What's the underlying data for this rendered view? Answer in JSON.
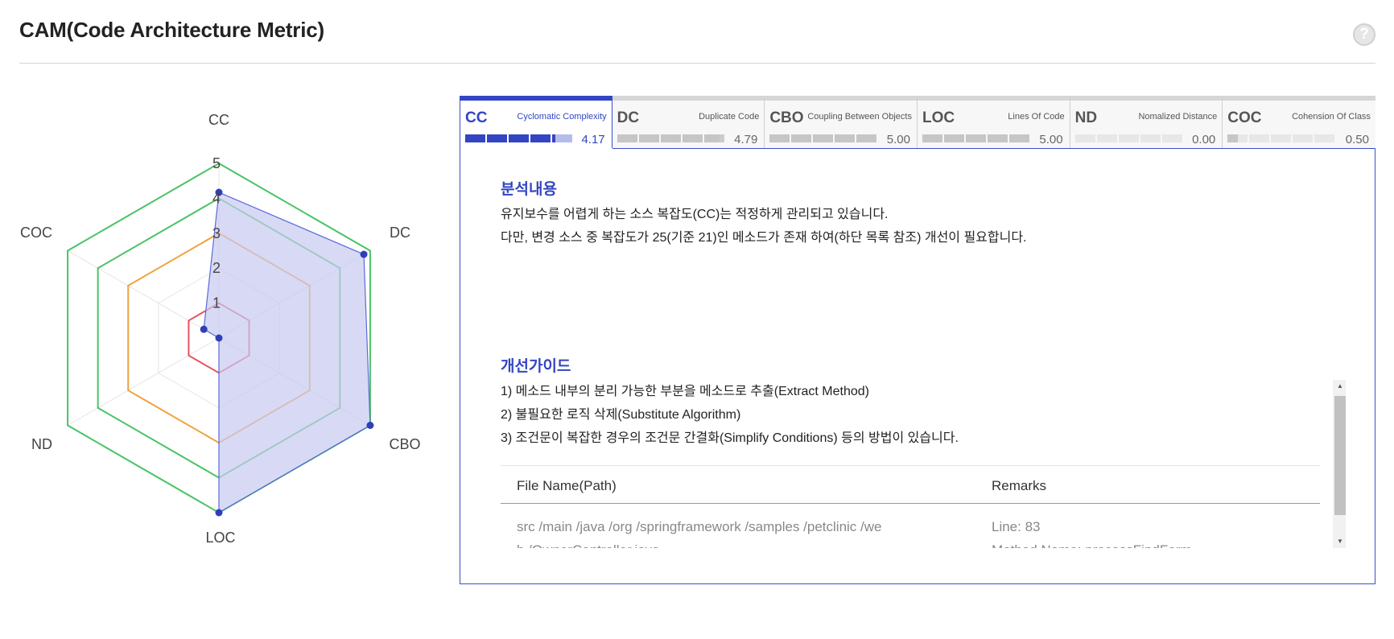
{
  "header": {
    "title": "CAM(Code Architecture Metric)",
    "help_glyph": "?"
  },
  "chart_data": {
    "type": "radar",
    "axes": [
      "CC",
      "DC",
      "CBO",
      "LOC",
      "ND",
      "COC"
    ],
    "values": [
      4.17,
      4.79,
      5.0,
      5.0,
      0.0,
      0.5
    ],
    "rmax": 5,
    "tick_labels": [
      "1",
      "2",
      "3",
      "4",
      "5"
    ],
    "reference_levels": [
      {
        "level": 1,
        "color": "#e8555f"
      },
      {
        "level": 3,
        "color": "#f0a23c"
      },
      {
        "level": 4,
        "color": "#49c466"
      },
      {
        "level": 5,
        "color": "#49c466"
      }
    ],
    "series_fill": "#c7cbf1",
    "series_stroke": "#5a6ad8",
    "point_color": "#2f3fb8"
  },
  "tabs": [
    {
      "abbr": "CC",
      "full": "Cyclomatic Complexity",
      "score": "4.17",
      "value": 4.17,
      "active": true
    },
    {
      "abbr": "DC",
      "full": "Duplicate Code",
      "score": "4.79",
      "value": 4.79,
      "active": false
    },
    {
      "abbr": "CBO",
      "full": "Coupling Between Objects",
      "score": "5.00",
      "value": 5.0,
      "active": false
    },
    {
      "abbr": "LOC",
      "full": "Lines Of Code",
      "score": "5.00",
      "value": 5.0,
      "active": false
    },
    {
      "abbr": "ND",
      "full": "Nomalized Distance",
      "score": "0.00",
      "value": 0.0,
      "active": false
    },
    {
      "abbr": "COC",
      "full": "Cohension Of Class",
      "score": "0.50",
      "value": 0.5,
      "active": false
    }
  ],
  "analysis": {
    "title": "분석내용",
    "line1": "유지보수를 어렵게 하는 소스 복잡도(CC)는 적정하게 관리되고 있습니다.",
    "line2": "다만, 변경 소스 중 복잡도가 25(기준 21)인 메소드가 존재 하여(하단 목록 참조) 개선이 필요합니다."
  },
  "guide": {
    "title": "개선가이드",
    "line1": "1) 메소드 내부의 분리 가능한 부분을 메소드로 추출(Extract Method)",
    "line2": "2) 불필요한 로직 삭제(Substitute Algorithm)",
    "line3": "3) 조건문이 복잡한 경우의 조건문 간결화(Simplify Conditions) 등의 방법이 있습니다."
  },
  "table": {
    "col_file": "File Name(Path)",
    "col_remarks": "Remarks",
    "row1": {
      "file_line1": "src /main /java /org /springframework /samples /petclinic /we",
      "file_line2": "b /OwnerController.java",
      "remarks_line1": "Line: 83",
      "remarks_line2": "Method Name: processFindForm"
    }
  }
}
